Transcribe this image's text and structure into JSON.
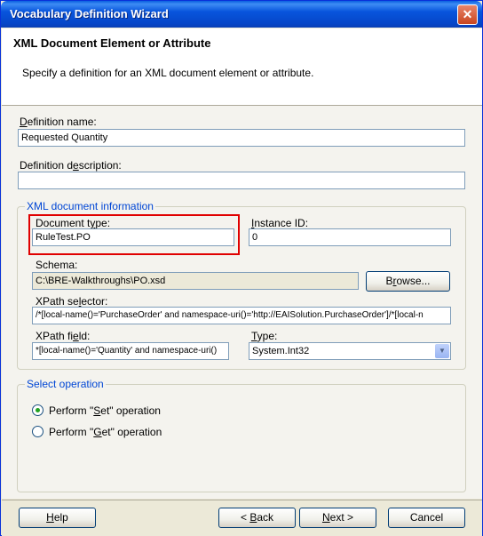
{
  "window": {
    "title": "Vocabulary Definition Wizard",
    "close_glyph": "✕"
  },
  "header": {
    "title": "XML Document Element or Attribute",
    "description": "Specify a definition for an XML document element or attribute."
  },
  "definition_name": {
    "label_prefix": "D",
    "label_rest": "efinition name:",
    "value": "Requested Quantity"
  },
  "definition_description": {
    "label_prefix": "Definition d",
    "label_mid": "e",
    "label_rest": "scription:",
    "value": ""
  },
  "xml_info": {
    "group_title": "XML document information",
    "document_type": {
      "label_prefix": "Document t",
      "label_mid": "y",
      "label_rest": "pe:",
      "value": "RuleTest.PO"
    },
    "instance_id": {
      "label_prefix": "I",
      "label_rest": "nstance ID:",
      "value": "0"
    },
    "schema": {
      "label": "Schema:",
      "value": "C:\\BRE-Walkthroughs\\PO.xsd"
    },
    "browse_button": {
      "prefix": "B",
      "mid": "r",
      "rest": "owse..."
    },
    "xpath_selector": {
      "label_prefix": "XPath se",
      "label_mid": "l",
      "label_rest": "ector:",
      "value": "/*[local-name()='PurchaseOrder' and namespace-uri()='http://EAISolution.PurchaseOrder']/*[local-n"
    },
    "xpath_field": {
      "label_prefix": "XPath fi",
      "label_mid": "e",
      "label_rest": "ld:",
      "value": "*[local-name()='Quantity' and namespace-uri()"
    },
    "type": {
      "label_prefix": "",
      "label_mid": "T",
      "label_rest": "ype:",
      "value": "System.Int32",
      "arrow": "▼"
    }
  },
  "operation": {
    "group_title": "Select operation",
    "set": {
      "prefix": "Perform \"",
      "mid": "S",
      "rest": "et\" operation",
      "selected": true
    },
    "get": {
      "prefix": "Perform \"",
      "mid": "G",
      "rest": "et\" operation",
      "selected": false
    }
  },
  "footer": {
    "help": {
      "prefix": "",
      "mid": "H",
      "rest": "elp"
    },
    "back": {
      "prefix": "< ",
      "mid": "B",
      "rest": "ack"
    },
    "next": {
      "prefix": "",
      "mid": "N",
      "rest": "ext >"
    },
    "cancel": "Cancel"
  }
}
